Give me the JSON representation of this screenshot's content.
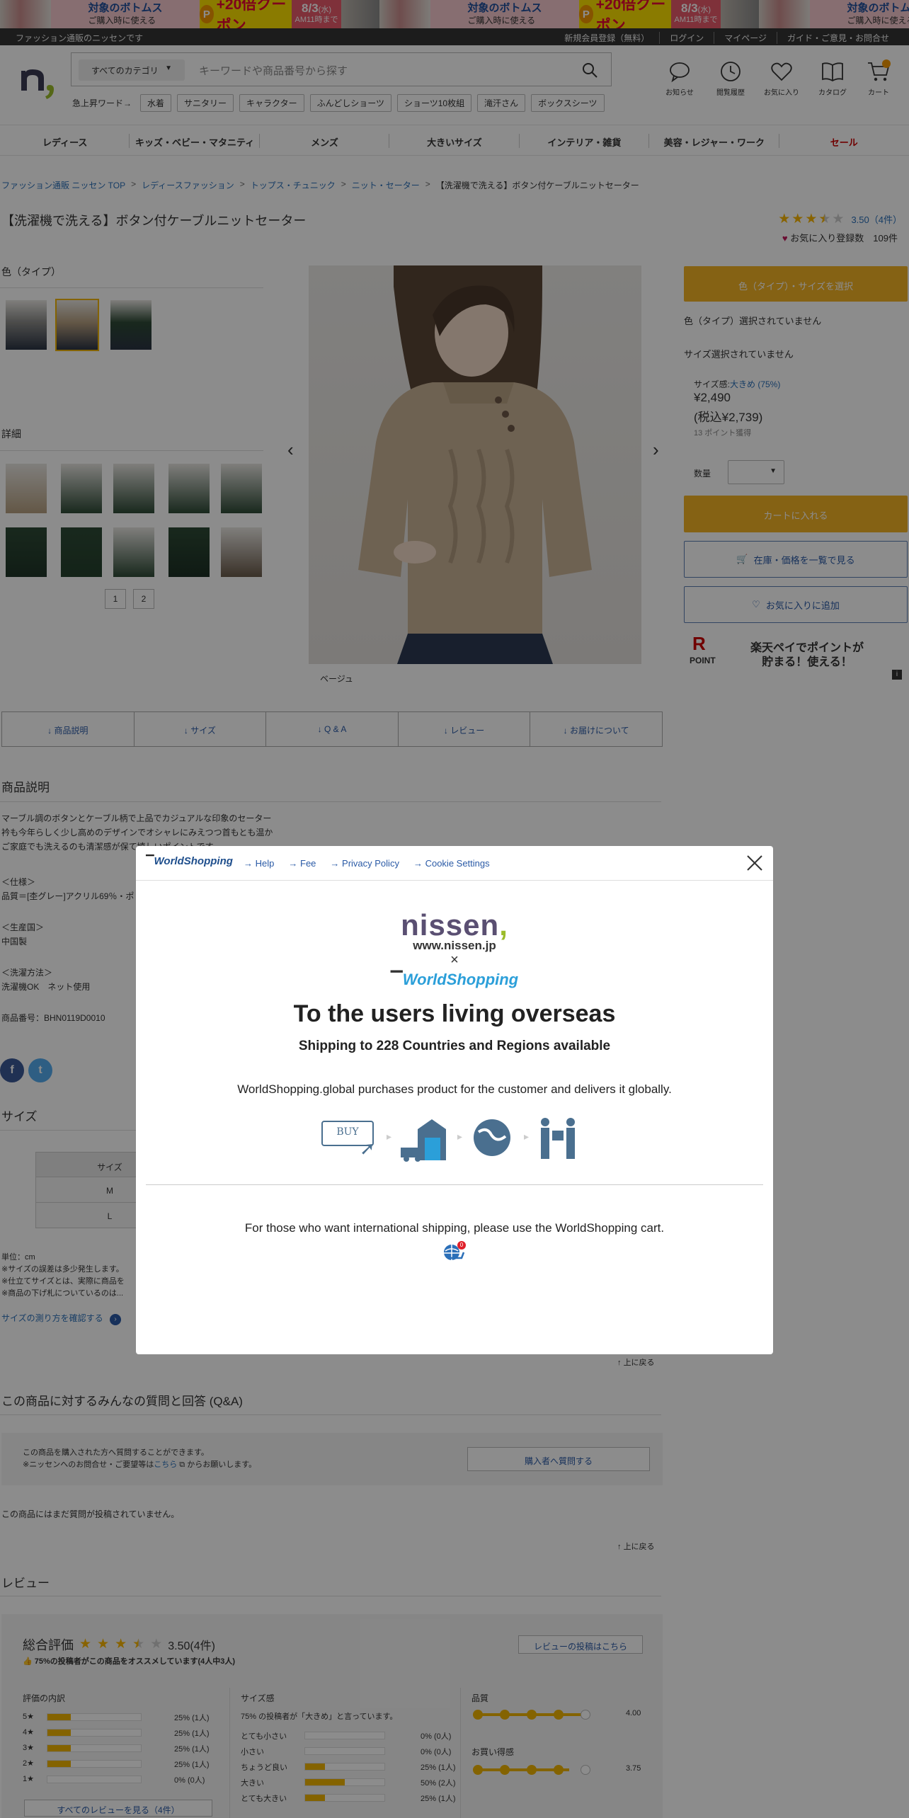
{
  "banner": {
    "main_text": "対象のボトムス",
    "sub_text": "ご購入時に使える",
    "coupon_p": "P",
    "coupon": "+20倍クーポン",
    "date": "8/3",
    "weekday": "(水)",
    "time": "AM11時まで"
  },
  "topbar": {
    "site_label": "ファッション通販のニッセンです",
    "links": [
      "新規会員登録（無料）",
      "ログイン",
      "マイページ",
      "ガイド・ご意見・お問合せ"
    ]
  },
  "header": {
    "category_select": "すべてのカテゴリ",
    "search_placeholder": "キーワードや商品番号から探す",
    "hotwords_label": "急上昇ワード→",
    "hotwords": [
      "水着",
      "サニタリー",
      "キャラクター",
      "ふんどしショーツ",
      "ショーツ10枚組",
      "滝汗さん",
      "ボックスシーツ"
    ],
    "icons": [
      "お知らせ",
      "閲覧履歴",
      "お気に入り",
      "カタログ",
      "カート"
    ]
  },
  "nav": [
    "レディース",
    "キッズ・ベビー・マタニティ",
    "メンズ",
    "大きいサイズ",
    "インテリア・雑貨",
    "美容・レジャー・ワーク",
    "セール"
  ],
  "breadcrumb": [
    "ファッション通販 ニッセン TOP",
    "レディースファッション",
    "トップス・チュニック",
    "ニット・セーター",
    "【洗濯機で洗える】ボタン付ケーブルニットセーター"
  ],
  "product": {
    "title": "【洗濯機で洗える】ボタン付ケーブルニットセーター",
    "rating": "3.50（4件）",
    "fav_label": "お気に入り登録数",
    "fav_count": "109件",
    "color_heading": "色（タイプ）",
    "detail_heading": "詳細",
    "pages": [
      "1",
      "2"
    ],
    "image_caption": "ベージュ"
  },
  "panel": {
    "select_button": "色（タイプ）・サイズを選択",
    "color_label": "色（タイプ）",
    "color_value": "選択されていません",
    "size_label": "サイズ",
    "size_value": "選択されていません",
    "size_feel_label": "サイズ感:",
    "size_feel_value": "大きめ (75%)",
    "price": "¥2,490",
    "price_tax": "(税込¥2,739)",
    "points": "13 ポイント獲得",
    "qty_label": "数量",
    "cart_button": "カートに入れる",
    "stock_button": "在庫・価格を一覧で見る",
    "fav_button": "お気に入りに追加",
    "rakuten_line1": "楽天ペイでポイントが",
    "rakuten_line2": "貯まる！使える！",
    "rakuten_point": "POINT",
    "rakuten_r": "R",
    "info_icon": "i"
  },
  "tabs": [
    "商品説明",
    "サイズ",
    "Q & A",
    "レビュー",
    "お届けについて"
  ],
  "description": {
    "heading": "商品説明",
    "lines": [
      "マーブル調のボタンとケーブル柄で上品でカジュアルな印象のセーター",
      "衿も今年らしく少し高めのデザインでオシャレにみえつつ首もとも温か",
      "ご家庭でも洗えるのも清潔感が保て嬉しいポイントです。"
    ],
    "spec_heading": "＜仕様＞",
    "spec": "品質＝[杢グレー]アクリル69％・ポ",
    "origin_heading": "＜生産国＞",
    "origin": "中国製",
    "wash_heading": "＜洗濯方法＞",
    "wash": "洗濯機OK　ネット使用",
    "code": "商品番号：BHN0119D0010"
  },
  "social": [
    "f",
    "t"
  ],
  "size": {
    "heading": "サイズ",
    "table": [
      "サイズ",
      "M",
      "L"
    ],
    "notes": [
      "単位：cm",
      "※サイズの誤差は多少発生します。",
      "※仕立てサイズとは、実際に商品を",
      "※商品の下げ札についているのは..."
    ],
    "measure_link": "サイズの測り方を確認する"
  },
  "back_to_top": "上に戻る",
  "qa": {
    "heading": "この商品に対するみんなの質問と回答 (Q&A)",
    "line1": "この商品を購入された方へ質問することができます。",
    "line2_pre": "※ニッセンへのお問合せ・ご要望等は",
    "line2_link": "こちら",
    "line2_post": "からお願いします。",
    "button": "購入者へ質問する",
    "empty": "この商品にはまだ質問が投稿されていません。"
  },
  "review": {
    "heading": "レビュー",
    "overall_label": "総合評価",
    "overall": "3.50(4件)",
    "recommend": "75%の投稿者がこの商品をオススメしています(4人中3人)",
    "post_button": "レビューの投稿はこちら",
    "breakdown_heading": "評価の内訳",
    "breakdown": [
      {
        "label": "5★",
        "pct": 0.25,
        "text": "25% (1人)"
      },
      {
        "label": "4★",
        "pct": 0.25,
        "text": "25% (1人)"
      },
      {
        "label": "3★",
        "pct": 0.25,
        "text": "25% (1人)"
      },
      {
        "label": "2★",
        "pct": 0.25,
        "text": "25% (1人)"
      },
      {
        "label": "1★",
        "pct": 0,
        "text": "0% (0人)"
      }
    ],
    "size_heading": "サイズ感",
    "size_summary": "75% の投稿者が「大きめ」と言っています。",
    "size_rows": [
      {
        "label": "とても小さい",
        "pct": 0,
        "text": "0% (0人)"
      },
      {
        "label": "小さい",
        "pct": 0,
        "text": "0% (0人)"
      },
      {
        "label": "ちょうど良い",
        "pct": 0.25,
        "text": "25% (1人)"
      },
      {
        "label": "大きい",
        "pct": 0.5,
        "text": "50% (2人)"
      },
      {
        "label": "とても大きい",
        "pct": 0.25,
        "text": "25% (1人)"
      }
    ],
    "quality_heading": "品質",
    "quality": "4.00",
    "value_heading": "お買い得感",
    "value": "3.75",
    "all_button": "すべてのレビューを見る（4件）"
  },
  "modal": {
    "logo_small": "WorldShopping",
    "links": [
      "Help",
      "Fee",
      "Privacy Policy",
      "Cookie Settings"
    ],
    "nissen_logo": "nissen",
    "nissen_url": "www.nissen.jp",
    "times": "×",
    "ws_logo": "WorldShopping",
    "title": "To the users living overseas",
    "subtitle": "Shipping to 228 Countries and Regions available",
    "desc": "WorldShopping.global purchases product for the customer and delivers it globally.",
    "buy": "BUY",
    "footer": "For those who want international shipping, please use the WorldShopping cart.",
    "cart_badge": "0"
  }
}
